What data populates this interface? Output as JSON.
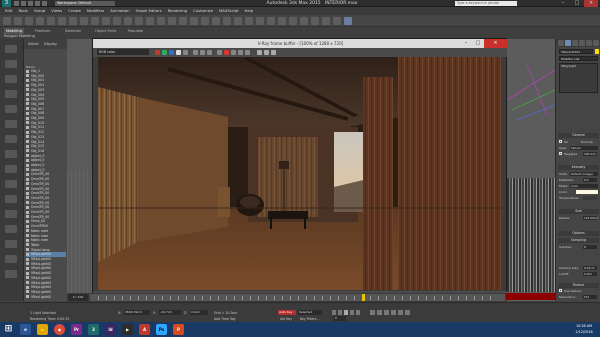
{
  "app": {
    "title": "Autodesk 3ds Max 2015",
    "file": "INTERIOR.max",
    "workspace": "Workspace: Default",
    "search_placeholder": "Type a keyword or phrase"
  },
  "menu": [
    "Edit",
    "Tools",
    "Group",
    "Views",
    "Create",
    "Modifiers",
    "Animation",
    "Graph Editors",
    "Rendering",
    "Customize",
    "MAXScript",
    "Help"
  ],
  "ribbon": {
    "tabs": [
      "Modeling",
      "Freeform",
      "Selection",
      "Object Paint",
      "Populate"
    ],
    "sub": "Polygon Modeling"
  },
  "explorer": {
    "tabs": [
      "Select",
      "Display"
    ],
    "name_header": "Name",
    "rows": [
      "Obj_1",
      "Obj_000",
      "Obj_001",
      "Obj_002",
      "Obj_003",
      "Obj_004",
      "Obj_005",
      "Obj_006",
      "Obj_007",
      "Obj_008",
      "Obj_009",
      "Obj_010",
      "Obj_011",
      "Obj_012",
      "Obj_013",
      "Obj_014",
      "Obj_015",
      "Obj_016",
      "object_0",
      "object_0",
      "object_0",
      "object_0",
      "OmniTR_00",
      "OmniTR_00",
      "OmniTR_00",
      "OmniTR_00",
      "OmniTR_00",
      "OmniTR_00",
      "OmniTR_00",
      "OmniTR_00",
      "OmniTR_00",
      "OmniTR_00",
      "Omni_00",
      "OmniTR00",
      "fabric nam",
      "fabric nam",
      "fabric nam",
      "Table",
      "Tripod lamp",
      "VRayLight00",
      "VRayLight00",
      "VRayLight00",
      "VRayLight00",
      "VRayLight00",
      "VRayLight00",
      "VRayLight00",
      "VRayLight00",
      "VRayLight00",
      "VRayLight00"
    ],
    "selected_row": 39
  },
  "vfb": {
    "title": "V-Ray frame buffer - [100% of 1280 x 720]",
    "channel": "RGB color"
  },
  "command_panel": {
    "object_name": "VRayLight01",
    "modifier_list": "Modifier List",
    "stack_item": "VRayLight",
    "general": "General",
    "on_label": "On",
    "exclude": "Exclude",
    "type_label": "Type:",
    "type_value": "Sphere",
    "targeted_label": "Targeted",
    "targeted_value": "200.0cm",
    "intensity": "Intensity",
    "units_label": "Units:",
    "units_value": "Default (image)",
    "multiplier_label": "Multiplier:",
    "multiplier_value": "0.0",
    "mode_label": "Mode:",
    "mode_value": "Color",
    "color_label": "Color:",
    "temperature_label": "Temperature:",
    "size": "Size",
    "radius_label": "Radius:",
    "radius_value": "125.99cm",
    "options": "Options",
    "sampling": "Sampling",
    "subdivs_label": "Subdivs:",
    "subdivs_value": "8",
    "shadow_bias_label": "Shadow bias:",
    "shadow_bias_value": "0.02cm",
    "cutoff_label": "Cutoff:",
    "cutoff_value": "0.001",
    "texture": "Texture",
    "use_texture": "Use texture",
    "resolution_label": "Resolution:",
    "resolution_value": "512"
  },
  "status": {
    "frame_label": "0 / 100",
    "selection": "1 Light Selected",
    "render_time": "Rendering Time: 0:00:33",
    "x_label": "X:",
    "x_value": "3694.59cm",
    "y_label": "Y:",
    "y_value": "-10.7cm",
    "z_label": "Z:",
    "z_value": "0.0cm",
    "grid": "Grid = 10.0cm",
    "add_tag": "Add Time Tag",
    "auto_key": "Auto Key",
    "selected": "Selected",
    "set_key": "Set Key",
    "key_filters": "Key Filters...",
    "frame_field": "0"
  },
  "taskbar": {
    "time": "10:28 AM",
    "date": "1/12/2016"
  },
  "colors": {
    "accent": "#5b7fa6",
    "timeline_red": "#8c0000",
    "autokey": "#b32f2f",
    "taskbar": "#1a3a66"
  }
}
